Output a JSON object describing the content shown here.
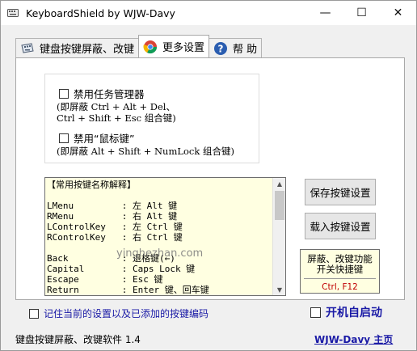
{
  "window": {
    "title": "KeyboardShield by WJW-Davy",
    "controls": {
      "minimize": "—",
      "maximize": "☐",
      "close": "✕"
    }
  },
  "tabs": [
    {
      "label": "键盘按键屏蔽、改键",
      "icon": "keyboard-icon",
      "active": false
    },
    {
      "label": "更多设置",
      "icon": "chrome-settings-icon",
      "active": true
    },
    {
      "label": "帮 助",
      "icon": "help-icon",
      "active": false
    }
  ],
  "options": {
    "disable_task_manager": {
      "label": "禁用任务管理器",
      "checked": false
    },
    "task_manager_note_1": "(即屏蔽 Ctrl + Alt + Del、",
    "task_manager_note_2": "Ctrl + Shift + Esc 组合键)",
    "disable_mouse_keys": {
      "label": "禁用“鼠标键”",
      "checked": false
    },
    "mouse_keys_note": "(即屏蔽 Alt + Shift + NumLock 组合键)"
  },
  "key_reference": {
    "text": "【常用按键名称解释】\n\nLMenu         : 左 Alt 键\nRMenu         : 右 Alt 键\nLControlKey   : 左 Ctrl 键\nRControlKey   : 右 Ctrl 键\n\nBack          : 退格键(←)\nCapital       : Caps Lock 键\nEscape        : Esc 键\nReturn        : Enter 键、回车键"
  },
  "buttons": {
    "save": "保存按键设置",
    "load": "载入按键设置"
  },
  "hotkey": {
    "title": "屏蔽、改键功能\n开关快捷键",
    "keys": "Ctrl, F12"
  },
  "remember": {
    "label": "记住当前的设置以及已添加的按键编码",
    "checked": false
  },
  "autostart": {
    "label": "开机自启动",
    "checked": false
  },
  "footer": {
    "version": "键盘按键屏蔽、改键软件 1.4",
    "homepage": "WJW-Davy 主页"
  },
  "watermark": "yinghezhan.com",
  "colors": {
    "link": "#1a1aa6",
    "hotkey": "#c00000",
    "memo_bg": "#ffffe1"
  }
}
